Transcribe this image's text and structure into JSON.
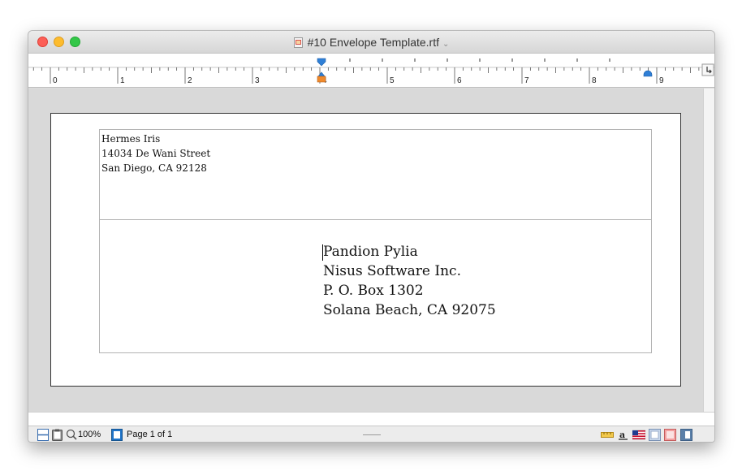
{
  "window": {
    "title": "#10 Envelope Template.rtf",
    "title_chevron": "⌄"
  },
  "ruler": {
    "numbers": [
      "0",
      "1",
      "2",
      "3",
      "4",
      "5",
      "6",
      "7",
      "8",
      "9"
    ]
  },
  "return_address": {
    "lines": [
      "Hermes Iris",
      "14034 De Wani Street",
      "San Diego, CA 92128"
    ]
  },
  "destination_address": {
    "lines": [
      "Pandion Pylia",
      "Nisus Software Inc.",
      "P. O. Box 1302",
      "Solana Beach, CA 92075"
    ]
  },
  "statusbar": {
    "zoom": "100%",
    "page": "Page 1 of 1"
  },
  "icons": {
    "split-view": "split-view-icon",
    "clipboard": "clipboard-icon",
    "zoom": "magnifier-icon",
    "page-view": "page-view-icon",
    "ruler-toggle": "ruler-icon",
    "font-style": "font-style-icon",
    "language": "us-flag-icon",
    "grid": "grid-icon",
    "red-box": "highlight-icon",
    "sidebar": "sidebar-icon",
    "tab-corner": "tab-type-icon"
  },
  "colors": {
    "ruler_marker": "#2f7fd6",
    "indent_marker": "#f08a2c",
    "accent_blue": "#1e73c8"
  }
}
